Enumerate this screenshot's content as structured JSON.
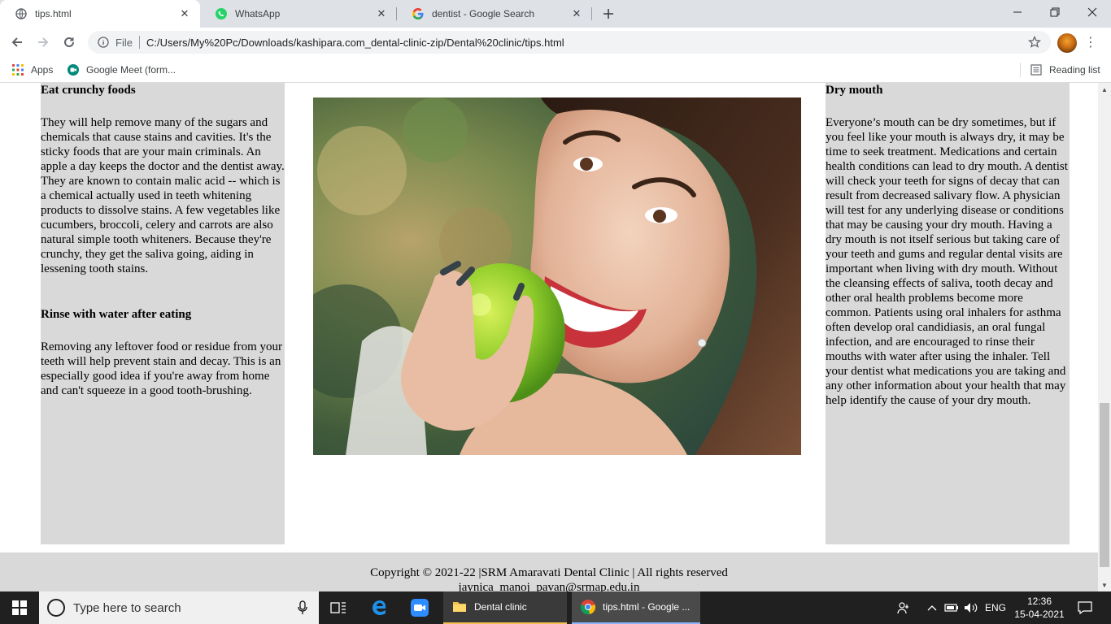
{
  "browser": {
    "tabs": [
      {
        "title": "tips.html",
        "icon": "globe-icon",
        "active": true
      },
      {
        "title": "WhatsApp",
        "icon": "whatsapp-icon",
        "active": false
      },
      {
        "title": "dentist - Google Search",
        "icon": "google-icon",
        "active": false
      }
    ],
    "address": {
      "scheme_label": "File",
      "url": "C:/Users/My%20Pc/Downloads/kashipara.com_dental-clinic-zip/Dental%20clinic/tips.html"
    },
    "bookmarks": {
      "apps_label": "Apps",
      "meet_label": "Google Meet (form...",
      "reading_list_label": "Reading list"
    }
  },
  "page": {
    "left": {
      "heading1": "Eat crunchy foods",
      "paragraph1": "They will help remove many of the sugars and chemicals that cause stains and cavities. It's the sticky foods that are your main criminals. An apple a day keeps the doctor and the dentist away. They are known to contain malic acid -- which is a chemical actually used in teeth whitening products to dissolve stains. A few vegetables like cucumbers, broccoli, celery and carrots are also natural simple tooth whiteners. Because they're crunchy, they get the saliva going, aiding in lessening tooth stains.",
      "heading2": "Rinse with water after eating",
      "paragraph2": "Removing any leftover food or residue from your teeth will help prevent stain and decay. This is an especially good idea if you're away from home and can't squeeze in a good tooth-brushing."
    },
    "right": {
      "heading": "Dry mouth",
      "paragraph": "Everyone’s mouth can be dry sometimes, but if you feel like your mouth is always dry, it may be time to seek treatment. Medications and certain health conditions can lead to dry mouth. A dentist will check your teeth for signs of decay that can result from decreased salivary flow. A physician will test for any underlying disease or conditions that may be causing your dry mouth. Having a dry mouth is not itself serious but taking care of your teeth and gums and regular dental visits are important when living with dry mouth. Without the cleansing effects of saliva, tooth decay and other oral health problems become more common. Patients using oral inhalers for asthma often develop oral candidiasis, an oral fungal infection, and are encouraged to rinse their mouths with water after using the inhaler. Tell your dentist what medications you are taking and any other information about your health that may help identify the cause of your dry mouth."
    },
    "footer": {
      "copyright": "Copyright © 2021-22 |SRM Amaravati Dental Clinic | All rights reserved",
      "email": "jaynica_manoj_pavan@srmap.edu.in"
    }
  },
  "taskbar": {
    "search_placeholder": "Type here to search",
    "apps": [
      {
        "label": "Dental clinic",
        "icon": "folder-icon"
      },
      {
        "label": "tips.html - Google ...",
        "icon": "chrome-icon"
      }
    ],
    "language": "ENG",
    "time": "12:36",
    "date": "15-04-2021"
  },
  "colors": {
    "panel_gray": "#d9d9d9",
    "tabbar": "#dee1e6",
    "taskbar": "#202020"
  }
}
